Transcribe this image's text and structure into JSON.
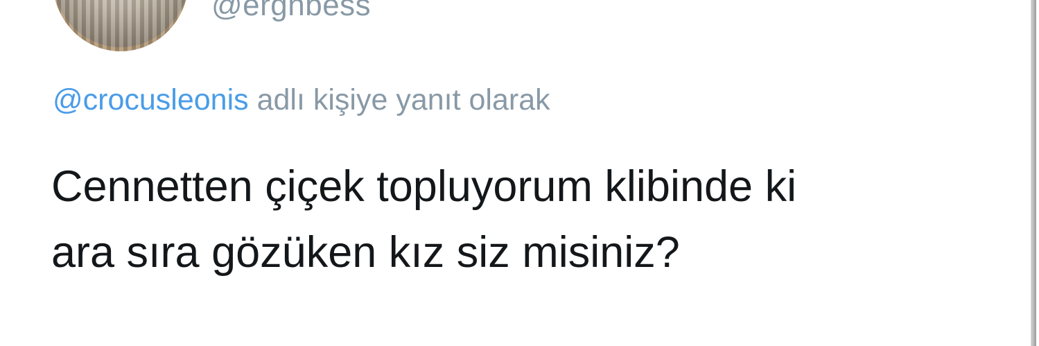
{
  "user": {
    "handle": "@ergnbess",
    "avatar_icon": "profile-photo"
  },
  "reply_context": {
    "mention": "@crocusleonis",
    "suffix": " adlı kişiye yanıt olarak"
  },
  "tweet": {
    "lines": [
      "Cennetten çiçek topluyorum klibinde ki",
      "ara sıra gözüken kız siz misiniz?"
    ]
  },
  "colors": {
    "mention": "#4a9ce8",
    "secondary_text": "#8899a6",
    "primary_text": "#14171a"
  }
}
